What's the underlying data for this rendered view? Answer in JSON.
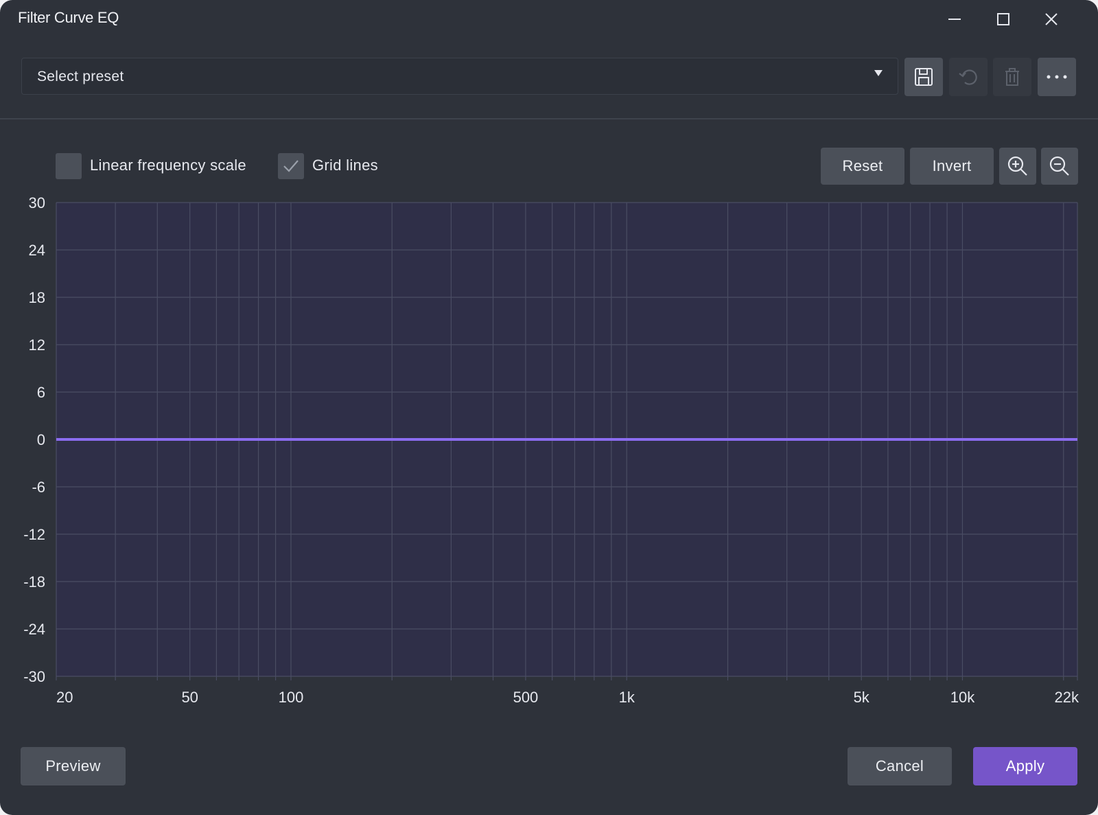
{
  "window": {
    "title": "Filter Curve EQ"
  },
  "preset": {
    "selected_label": "Select preset"
  },
  "options": {
    "linear_label": "Linear frequency scale",
    "linear_checked": false,
    "grid_label": "Grid lines",
    "grid_checked": true
  },
  "toolbar": {
    "reset_label": "Reset",
    "invert_label": "Invert"
  },
  "footer": {
    "preview_label": "Preview",
    "cancel_label": "Cancel",
    "apply_label": "Apply"
  },
  "colors": {
    "curve": "#8b6cf0",
    "plot_background": "#2f2f48",
    "grid": "#4a4d63",
    "accent": "#7655c9"
  },
  "chart_data": {
    "type": "line",
    "x_scale": "log",
    "xlim": [
      20,
      22000
    ],
    "ylim": [
      -30,
      30
    ],
    "x_ticks": [
      {
        "value": 20,
        "label": "20"
      },
      {
        "value": 50,
        "label": "50"
      },
      {
        "value": 100,
        "label": "100"
      },
      {
        "value": 500,
        "label": "500"
      },
      {
        "value": 1000,
        "label": "1k"
      },
      {
        "value": 5000,
        "label": "5k"
      },
      {
        "value": 10000,
        "label": "10k"
      },
      {
        "value": 22000,
        "label": "22k"
      }
    ],
    "y_ticks": [
      30,
      24,
      18,
      12,
      6,
      0,
      -6,
      -12,
      -18,
      -24,
      -30
    ],
    "grid": true,
    "series": [
      {
        "x": [
          20,
          22000
        ],
        "y": [
          0,
          0
        ]
      }
    ]
  }
}
